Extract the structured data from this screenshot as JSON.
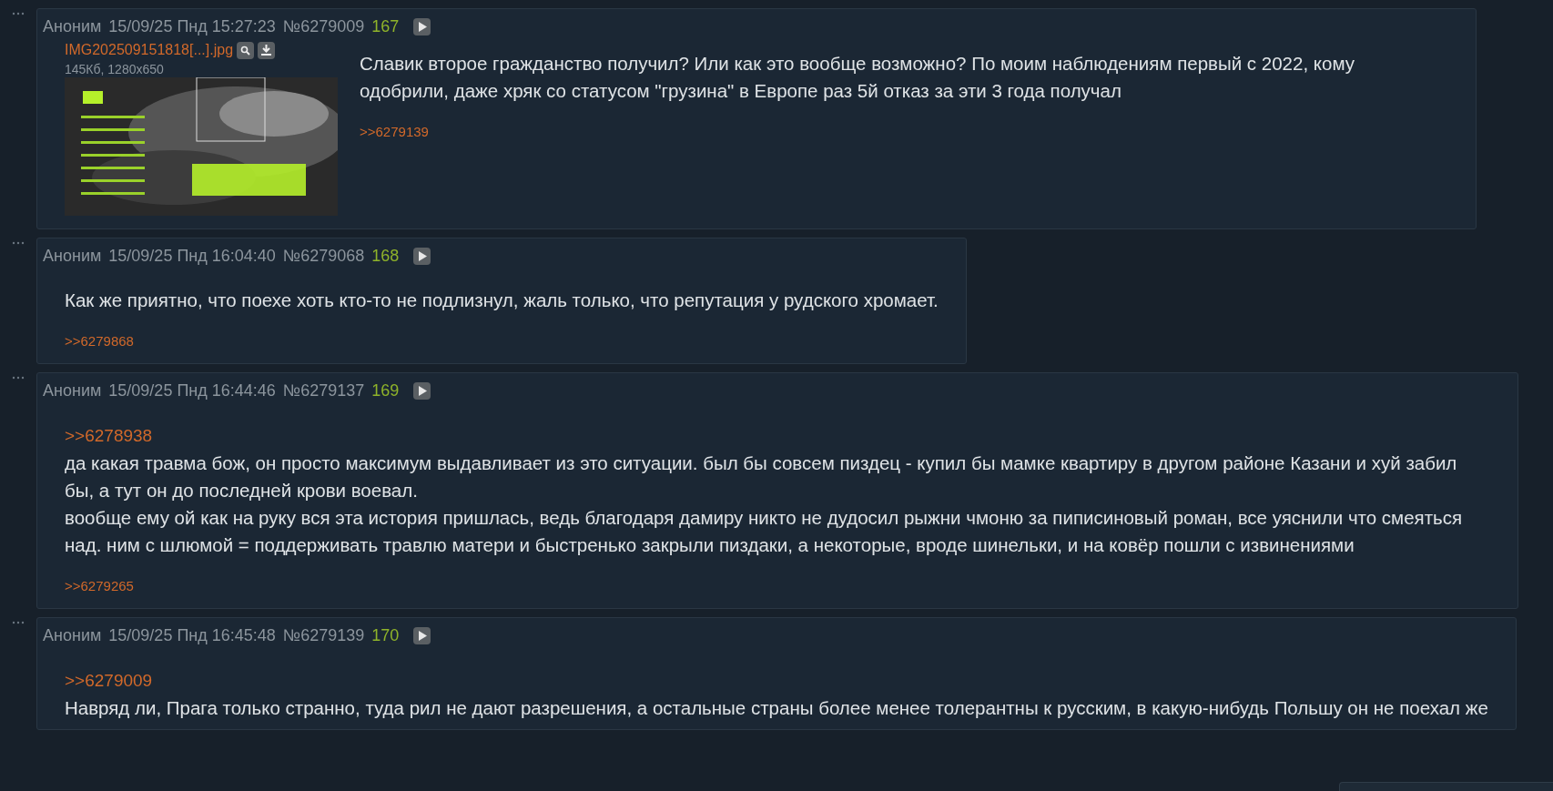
{
  "posts": [
    {
      "author": "Аноним",
      "date": "15/09/25 Пнд 15:27:23",
      "number": "№6279009",
      "index": "167",
      "file": {
        "name": "IMG202509151818[...].jpg",
        "meta": "145Кб, 1280x650",
        "kind": "picture"
      },
      "paragraphs": [
        "Славик второе гражданство получил? Или как это вообще возможно? По моим наблюдениям первый с 2022, кому одобрили, даже хряк со статусом \"грузина\" в Европе раз 5й отказ за эти 3 года получал"
      ],
      "replies": [
        ">>6279139"
      ]
    },
    {
      "author": "Аноним",
      "date": "15/09/25 Пнд 16:04:40",
      "number": "№6279068",
      "index": "168",
      "paragraphs": [
        "Как же приятно, что поехе хоть кто-то не подлизнул, жаль только, что репутация у рудского хромает."
      ],
      "replies": [
        ">>6279868"
      ]
    },
    {
      "author": "Аноним",
      "date": "15/09/25 Пнд 16:44:46",
      "number": "№6279137",
      "index": "169",
      "quote": ">>6278938",
      "paragraphs": [
        "да какая травма бож, он просто максимум выдавливает из это ситуации. был бы совсем пиздец - купил бы мамке квартиру в другом районе Казани и хуй забил бы, а тут он до последней крови воевал.",
        "вообще ему ой как на руку вся эта история пришлась, ведь благодаря дамиру никто не дудосил рыжни чмоню за пиписиновый роман, все уяснили что смеяться над. ним с шлюмой = поддерживать травлю матери и быстренько закрыли пиздаки, а некоторые, вроде шинельки, и на ковёр пошли с извинениями"
      ],
      "replies": [
        ">>6279265"
      ]
    },
    {
      "author": "Аноним",
      "date": "15/09/25 Пнд 16:45:48",
      "number": "№6279139",
      "index": "170",
      "quote": ">>6279009",
      "paragraphs": [
        "Навряд ли, Прага только странно, туда рил не дают разрешения, а остальные страны более менее толерантны к русским, в какую-нибудь Польшу он не поехал же"
      ]
    }
  ]
}
